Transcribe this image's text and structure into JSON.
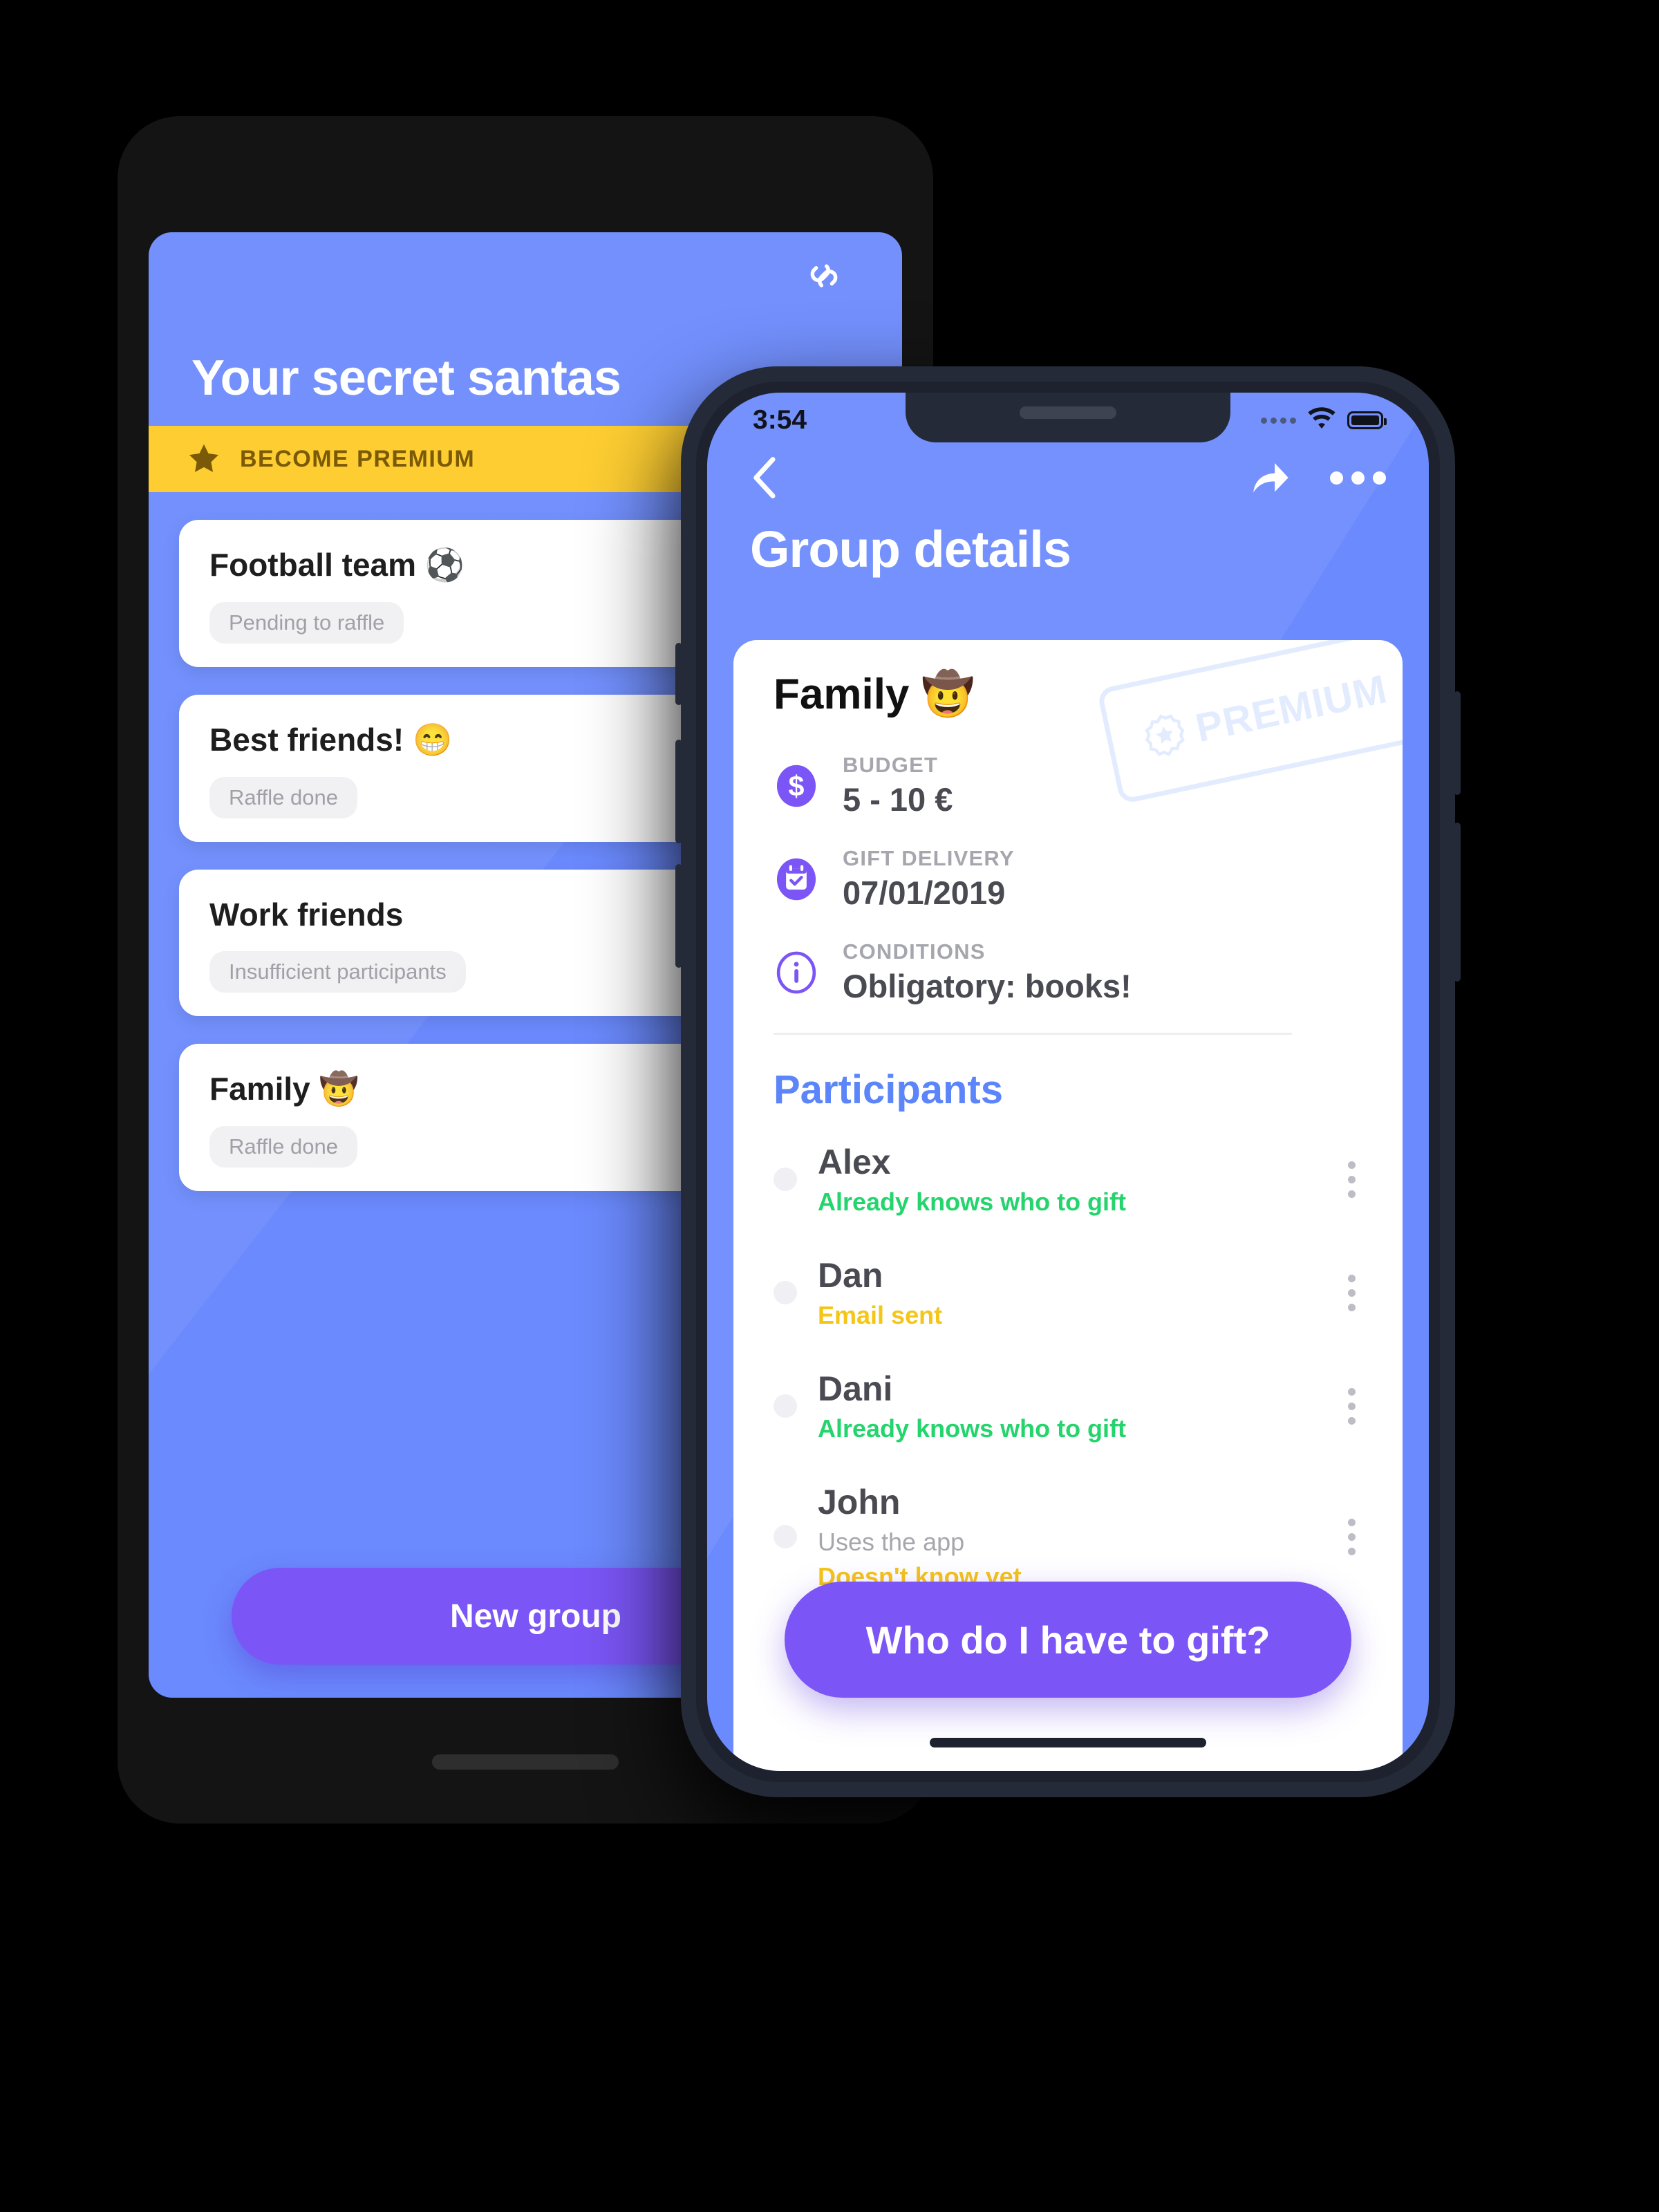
{
  "back_phone": {
    "app_bar": {
      "title": "Your secret santas",
      "link_icon": "link-icon"
    },
    "premium_banner": {
      "label": "BECOME PREMIUM",
      "icon": "star-icon",
      "bg_color": "#fdcd32",
      "text_color": "#7a5a07"
    },
    "groups": [
      {
        "name": "Football team ⚽",
        "status": "Pending to raffle"
      },
      {
        "name": "Best friends! 😁",
        "status": "Raffle done"
      },
      {
        "name": "Work friends",
        "status": "Insufficient participants"
      },
      {
        "name": "Family 🤠",
        "status": "Raffle done"
      }
    ],
    "new_group_button": "New group",
    "screen_bg": "#6b8afd"
  },
  "front_phone": {
    "status_bar": {
      "time": "3:54",
      "signal_icon": "signal-dots-icon",
      "wifi_icon": "wifi-icon",
      "battery_icon": "battery-icon"
    },
    "app_bar": {
      "back_icon": "chevron-left-icon",
      "share_icon": "share-arrow-icon",
      "more_icon": "more-dots-icon",
      "title": "Group details"
    },
    "group": {
      "name": "Family 🤠",
      "premium_stamp": "PREMIUM",
      "details": [
        {
          "icon": "dollar-circle-icon",
          "label": "BUDGET",
          "value": "5 - 10 €"
        },
        {
          "icon": "calendar-check-icon",
          "label": "GIFT DELIVERY",
          "value": "07/01/2019"
        },
        {
          "icon": "info-circle-icon",
          "label": "CONDITIONS",
          "value": "Obligatory: books!"
        }
      ]
    },
    "participants_title": "Participants",
    "participants": [
      {
        "name": "Alex",
        "status": "Already knows who to gift",
        "status_color": "green"
      },
      {
        "name": "Dan",
        "status": "Email sent",
        "status_color": "yellow"
      },
      {
        "name": "Dani",
        "status": "Already knows who to gift",
        "status_color": "green"
      },
      {
        "name": "John",
        "status": "Uses the app",
        "status_color": "grey"
      },
      {
        "name": "",
        "status": "Doesn't know yet",
        "status_color": "yellow"
      }
    ],
    "fab_label": "Who do I have to gift?",
    "accent_purple": "#7b55f6",
    "accent_blue": "#5b85f9"
  }
}
